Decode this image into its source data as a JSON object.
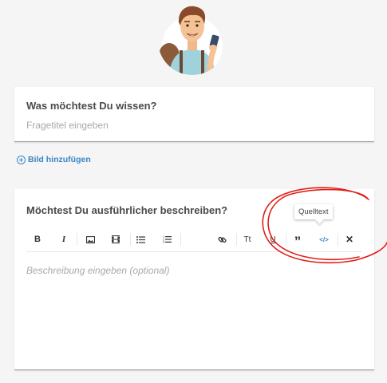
{
  "question_card": {
    "title": "Was möchtest Du wissen?",
    "placeholder": "Fragetitel eingeben"
  },
  "add_image": {
    "label": "Bild hinzufügen",
    "icon": "plus-circle-icon"
  },
  "description_card": {
    "title": "Möchtest Du ausführlicher beschreiben?",
    "placeholder": "Beschreibung eingeben (optional)"
  },
  "toolbar": {
    "buttons": [
      {
        "name": "bold-button",
        "icon": "bold-icon",
        "glyph": "B"
      },
      {
        "name": "italic-button",
        "icon": "italic-icon",
        "glyph": "I"
      },
      {
        "name": "image-button",
        "icon": "image-icon"
      },
      {
        "name": "video-button",
        "icon": "film-icon"
      },
      {
        "name": "bullet-list-button",
        "icon": "bullet-list-icon"
      },
      {
        "name": "numbered-list-button",
        "icon": "numbered-list-icon"
      },
      {
        "name": "link-button",
        "icon": "link-icon"
      },
      {
        "name": "text-size-button",
        "icon": "text-size-icon",
        "glyph": "Tt"
      },
      {
        "name": "underline-button",
        "icon": "underline-icon",
        "glyph": "U"
      },
      {
        "name": "quote-button",
        "icon": "quote-icon",
        "glyph": "”"
      },
      {
        "name": "source-code-button",
        "icon": "code-icon",
        "glyph": "</>"
      },
      {
        "name": "close-button",
        "icon": "close-icon",
        "glyph": "✕"
      }
    ],
    "active_color": "#3a86c5"
  },
  "tooltip": {
    "text": "Quelltext"
  },
  "colors": {
    "accent": "#3a86c5",
    "annotation": "#e0201a"
  }
}
